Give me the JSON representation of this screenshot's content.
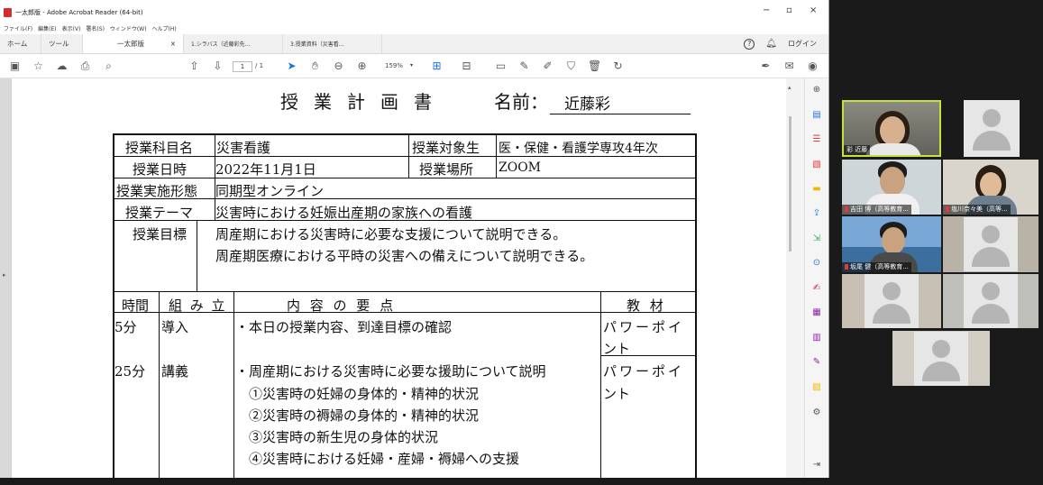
{
  "window": {
    "title": "一太郎版 - Adobe Acrobat Reader (64-bit)",
    "minimize": "−",
    "restore": "▫",
    "close": "×"
  },
  "menu": [
    "ファイル(F)",
    "編集(E)",
    "表示(V)",
    "署名(S)",
    "ウィンドウ(W)",
    "ヘルプ(H)"
  ],
  "tabs": {
    "home": "ホーム",
    "tools": "ツール",
    "active_doc": "一太郎版",
    "active_close": "×",
    "doc2": "1.シラバス（近藤彩先...",
    "doc3": "3.授業資料（災害看...",
    "login": "ログイン"
  },
  "toolbar": {
    "page_current": "1",
    "page_total": "/ 1",
    "zoom": "159%"
  },
  "document": {
    "title": "授業計画書",
    "name_label": "名前：",
    "name_value": "近藤彩",
    "rows": {
      "subject_label": "授業科目名",
      "subject_value": "災害看護",
      "target_label": "授業対象生",
      "target_value": "医・保健・看護学専攻4年次",
      "date_label": "授業日時",
      "date_value": "2022年11月1日",
      "place_label": "授業場所",
      "place_value": "ZOOM",
      "format_label": "授業実施形態",
      "format_value": "同期型オンライン",
      "theme_label": "授業テーマ",
      "theme_value": "災害時における妊娠出産期の家族への看護",
      "goal_label": "授業目標",
      "goal_line1": "周産期における災害時に必要な支援について説明できる。",
      "goal_line2": "周産期医療における平時の災害への備えについて説明できる。"
    },
    "schedule_header": {
      "time": "時間",
      "structure": "組 み 立",
      "content": "内 容 の 要 点",
      "material": "教 材"
    },
    "schedule": [
      {
        "time": "5分",
        "structure": "導入",
        "content": [
          "・本日の授業内容、到達目標の確認"
        ],
        "material": [
          "パワーポイ",
          "ント"
        ]
      },
      {
        "time": "25分",
        "structure": "講義",
        "content": [
          "・周産期における災害時に必要な援助について説明",
          "①災害時の妊婦の身体的・精神的状況",
          "②災害時の褥婦の身体的・精神的状況",
          "③災害時の新生児の身体的状況",
          "④災害時における妊婦・産婦・褥婦への支援"
        ],
        "material": [
          "パワーポイ",
          "ント"
        ]
      }
    ]
  },
  "participants": [
    {
      "name": "彩 近藤",
      "type": "video"
    },
    {
      "name": "",
      "type": "avatar"
    },
    {
      "name": "吉田 博（高等教育...",
      "type": "video"
    },
    {
      "name": "塩川奈々美（高等...",
      "type": "video"
    },
    {
      "name": "坂尾 健（高等教育...",
      "type": "video"
    },
    {
      "name": "",
      "type": "avatar"
    },
    {
      "name": "",
      "type": "avatar"
    },
    {
      "name": "",
      "type": "avatar"
    },
    {
      "name": "",
      "type": "avatar"
    }
  ],
  "colors": {
    "accent": "#1a73e8",
    "active_speaker": "#c6e23a",
    "mic_muted": "#e53935"
  }
}
